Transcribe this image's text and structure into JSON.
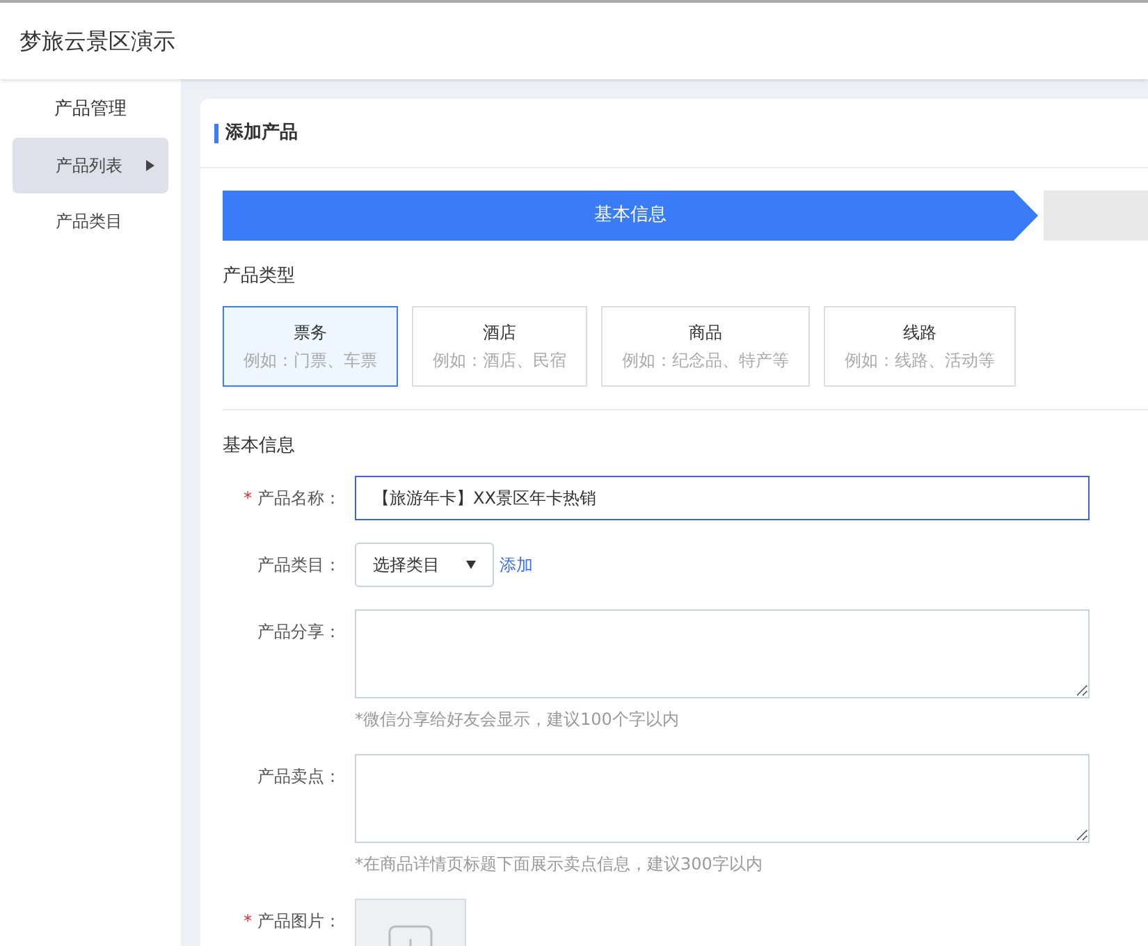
{
  "header": {
    "title": "梦旅云景区演示"
  },
  "sidebar": {
    "group": "产品管理",
    "items": [
      {
        "label": "产品列表",
        "selected": true
      },
      {
        "label": "产品类目",
        "selected": false
      }
    ]
  },
  "card": {
    "title": "添加产品"
  },
  "steps": [
    {
      "label": "基本信息",
      "selected": true
    }
  ],
  "product_type": {
    "heading": "产品类型",
    "options": [
      {
        "name": "票务",
        "example": "例如：门票、车票",
        "selected": true
      },
      {
        "name": "酒店",
        "example": "例如：酒店、民宿",
        "selected": false
      },
      {
        "name": "商品",
        "example": "例如：纪念品、特产等",
        "selected": false
      },
      {
        "name": "线路",
        "example": "例如：线路、活动等",
        "selected": false
      }
    ]
  },
  "basic_info": {
    "heading": "基本信息",
    "required_mark": "*",
    "fields": [
      {
        "kind": "text",
        "label": "产品名称：",
        "required": true,
        "value": "【旅游年卡】XX景区年卡热销",
        "focused": true
      },
      {
        "kind": "select",
        "label": "产品类目：",
        "required": false,
        "value": "选择类目",
        "link": "添加"
      },
      {
        "kind": "textarea",
        "label": "产品分享：",
        "required": false,
        "hint": "*微信分享给好友会显示，建议100个字以内"
      },
      {
        "kind": "textarea",
        "label": "产品卖点：",
        "required": false,
        "hint": "*在商品详情页标题下面展示卖点信息，建议300字以内"
      },
      {
        "kind": "upload",
        "label": "产品图片：",
        "required": true
      }
    ]
  }
}
